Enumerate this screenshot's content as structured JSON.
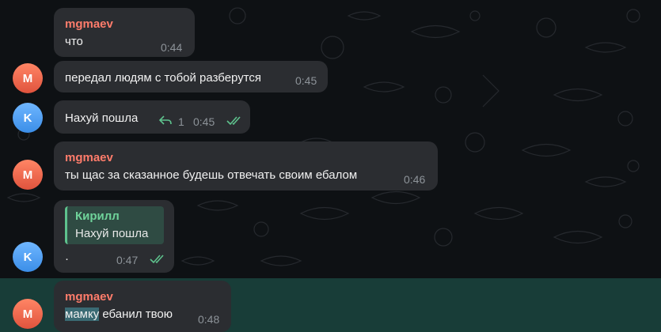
{
  "colors": {
    "background": "#0e1114",
    "bubble": "#2b2d31",
    "sender_name": "#ff7c6b",
    "reply_accent": "#5ec28d",
    "time": "#8d9399",
    "check": "#5ec28d",
    "highlight": "#19403a"
  },
  "messages": [
    {
      "avatar_letter": "",
      "sender": "mgmaev",
      "text": "что",
      "time": "0:44"
    },
    {
      "avatar_letter": "M",
      "sender": "",
      "text": "передал людям с тобой разберутся",
      "time": "0:45"
    },
    {
      "avatar_letter": "K",
      "sender": "",
      "text": "Нахуй пошла",
      "reply_count": "1",
      "time": "0:45",
      "icons": [
        "reply-arrow-icon",
        "double-check-icon"
      ]
    },
    {
      "avatar_letter": "M",
      "sender": "mgmaev",
      "text": "ты щас за сказанное будешь отвечать своим ебалом",
      "time": "0:46"
    },
    {
      "avatar_letter": "K",
      "sender": "",
      "reply_to": {
        "name": "Кирилл",
        "text": "Нахуй пошла"
      },
      "text": "·",
      "time": "0:47",
      "icons": [
        "double-check-icon"
      ]
    },
    {
      "avatar_letter": "M",
      "sender": "mgmaev",
      "text_highlighted": "мамку",
      "text": " ебанил твою",
      "time": "0:48"
    }
  ]
}
